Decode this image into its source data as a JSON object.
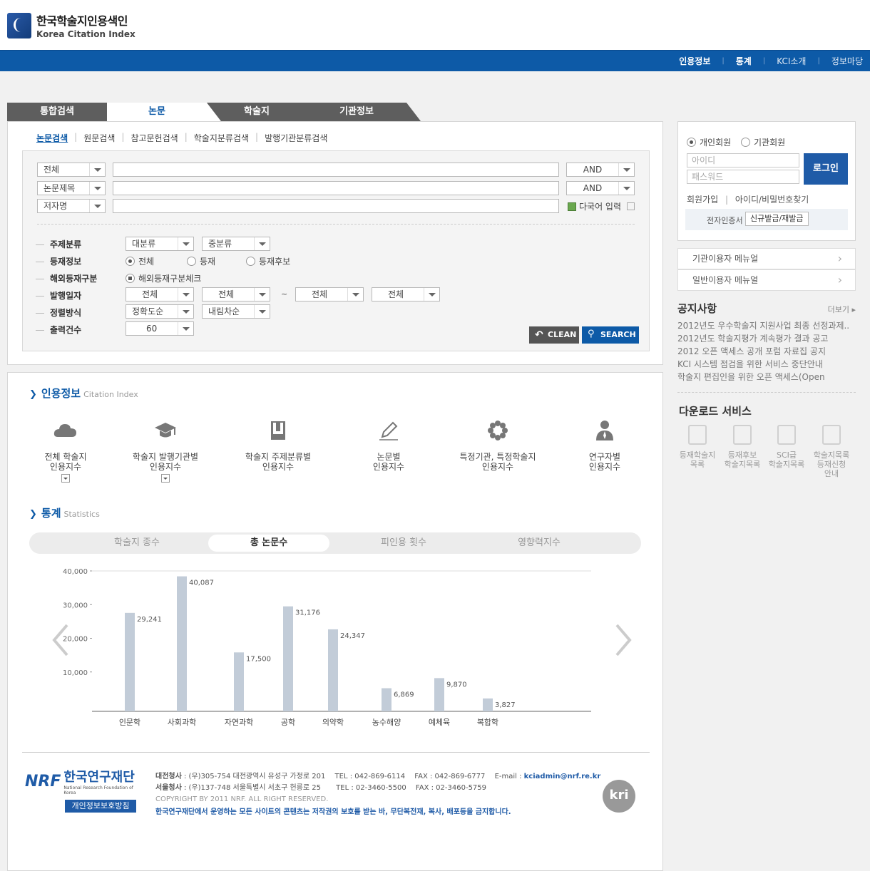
{
  "header": {
    "logo_ko": "한국학술지인용색인",
    "logo_en": "Korea Citation Index"
  },
  "topnav": [
    "인용정보",
    "통계",
    "KCI소개",
    "정보마당"
  ],
  "tabs": [
    "통합검색",
    "논문",
    "학술지",
    "기관정보"
  ],
  "subtabs": [
    "논문검색",
    "원문검색",
    "참고문헌검색",
    "학술지분류검색",
    "발행기관분류검색"
  ],
  "search": {
    "rows": [
      {
        "field": "전체",
        "op": "AND"
      },
      {
        "field": "논문제목",
        "op": "AND"
      },
      {
        "field": "저자명"
      }
    ],
    "multilang": "다국어 입력",
    "subject_label": "주제분류",
    "subject_major": "대분류",
    "subject_minor": "중분류",
    "publish_label": "등재정보",
    "publish_opts": [
      "전체",
      "등재",
      "등재후보"
    ],
    "overseas_label": "해외등재구분",
    "overseas_check": "해외등재구분체크",
    "date_label": "발행일자",
    "date_vals": [
      "전체",
      "전체",
      "전체",
      "전체"
    ],
    "date_sep": "~",
    "sort_label": "정렬방식",
    "sort_vals": [
      "정확도순",
      "내림차순"
    ],
    "count_label": "출력건수",
    "count_val": "60",
    "clean": "CLEAN",
    "submit": "SEARCH"
  },
  "citation": {
    "title": "인용정보",
    "subtitle": "Citation Index",
    "items": [
      {
        "line1": "전체 학술지",
        "line2": "인용지수",
        "icon": "cloud-icon"
      },
      {
        "line1": "학술지 발행기관별",
        "line2": "인용지수",
        "icon": "graduation-cap-icon"
      },
      {
        "line1": "학술지 주제분류별",
        "line2": "인용지수",
        "icon": "book-icon"
      },
      {
        "line1": "논문별",
        "line2": "인용지수",
        "icon": "pen-icon"
      },
      {
        "line1": "특정기관, 특정학술지",
        "line2": "인용지수",
        "icon": "flower-icon"
      },
      {
        "line1": "연구자별",
        "line2": "인용지수",
        "icon": "person-icon"
      }
    ]
  },
  "stats": {
    "title": "통계",
    "subtitle": "Statistics",
    "tabs": [
      "학술지 종수",
      "총 논문수",
      "피인용 횟수",
      "영향력지수"
    ]
  },
  "chart_data": {
    "type": "bar",
    "categories": [
      "인문학",
      "사회과학",
      "자연과학",
      "공학",
      "의약학",
      "농수해양",
      "예체육",
      "복합학"
    ],
    "values": [
      29241,
      40087,
      17500,
      31176,
      24347,
      6869,
      9870,
      3827
    ],
    "value_labels": [
      "29,241",
      "40,087",
      "17,500",
      "31,176",
      "24,347",
      "6,869",
      "9,870",
      "3,827"
    ],
    "yticks": [
      "10,000",
      "20,000",
      "30,000",
      "40,000"
    ],
    "ylim": [
      0,
      40000
    ],
    "color": "#c2ccd8"
  },
  "footer": {
    "org_ko": "한국연구재단",
    "org_en": "National Research Foundation of Korea",
    "privacy": "개인정보보호방침",
    "line1_label": "대전청사",
    "line1": " : (우)305-754 대전광역시 유성구 가정로 201",
    "line1_tel": "TEL : 042-869-6114",
    "line1_fax": "FAX : 042-869-6777",
    "email_label": "E-mail : ",
    "email": "kciadmin@nrf.re.kr",
    "line2_label": "서울청사",
    "line2": " : (우)137-748 서울특별시 서초구 헌릉로 25",
    "line2_tel": "TEL : 02-3460-5500",
    "line2_fax": "FAX : 02-3460-5759",
    "copyright": "COPYRIGHT BY 2011 NRF. ALL RIGHT RESERVED.",
    "notice": "한국연구재단에서 운영하는 모든 사이트의 콘텐츠는 저작권의 보호를 받는 바, 무단복전재, 복사, 배포등을 금지합니다.",
    "kri": "kri"
  },
  "login": {
    "personal": "개인회원",
    "org": "기관회원",
    "id_placeholder": "아이디",
    "pw_placeholder": "패스워드",
    "button": "로그인",
    "join": "회원가입",
    "sep": "|",
    "find": "아이디/비밀번호찾기",
    "cert_label": "전자인증서",
    "cert_button": "신규발급/재발급"
  },
  "manuals": [
    "기관이용자 메뉴얼",
    "일반이용자 메뉴얼"
  ],
  "notices": {
    "title": "공지사항",
    "more": "더보기 ▸",
    "items": [
      "2012년도 우수학술지 지원사업 최종 선정과제...",
      "2012년도 학술지평가 계속평가 결과 공고",
      "2012 오픈 액세스 공개 포럼 자료집 공지",
      "KCI 시스템 점검을 위한 서비스 중단안내",
      "학술지 편집인을 위한 오픈 액세스(Open"
    ]
  },
  "downloads": {
    "title": "다운로드 서비스",
    "items": [
      {
        "l1": "등재학술지",
        "l2": "목록",
        "l3": ""
      },
      {
        "l1": "등재후보",
        "l2": "학술지목록",
        "l3": ""
      },
      {
        "l1": "SCI급",
        "l2": "학술지목록",
        "l3": ""
      },
      {
        "l1": "학술지목록",
        "l2": "등재신청",
        "l3": "안내"
      }
    ]
  }
}
